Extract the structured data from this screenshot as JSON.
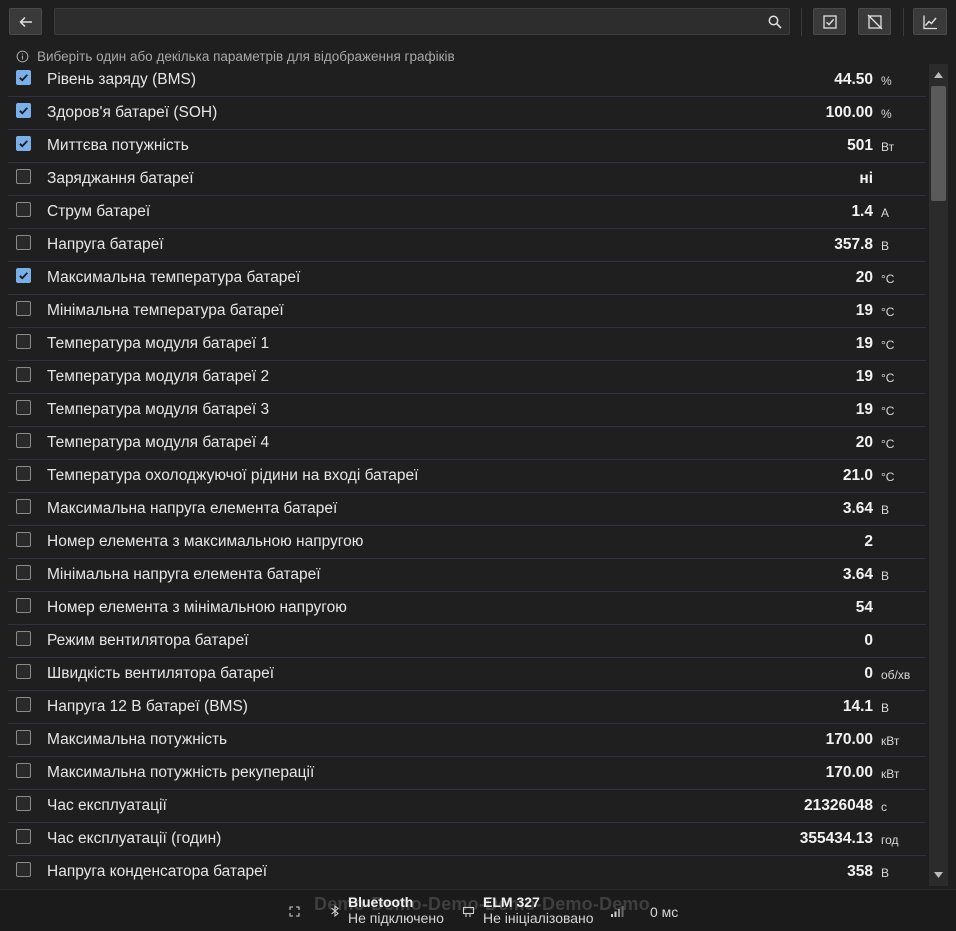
{
  "toolbar": {
    "search": {
      "value": "",
      "placeholder": ""
    },
    "icons": [
      "arrow-left-icon",
      "search-icon",
      "select-all-icon",
      "deselect-all-icon",
      "chart-icon"
    ]
  },
  "info": {
    "text": "Виберіть один або декілька параметрів для відображення графіків"
  },
  "parameters": [
    {
      "label": "Рівень заряду (BMS)",
      "value": "44.50",
      "unit": "%",
      "checked": true
    },
    {
      "label": "Здоров'я батареї (SOH)",
      "value": "100.00",
      "unit": "%",
      "checked": true
    },
    {
      "label": "Миттєва потужність",
      "value": "501",
      "unit": "Вт",
      "checked": true
    },
    {
      "label": "Заряджання батареї",
      "value": "ні",
      "unit": "",
      "checked": false
    },
    {
      "label": "Струм батареї",
      "value": "1.4",
      "unit": "А",
      "checked": false
    },
    {
      "label": "Напруга батареї",
      "value": "357.8",
      "unit": "В",
      "checked": false
    },
    {
      "label": "Максимальна температура батареї",
      "value": "20",
      "unit": "°C",
      "checked": true
    },
    {
      "label": "Мінімальна температура батареї",
      "value": "19",
      "unit": "°C",
      "checked": false
    },
    {
      "label": "Температура модуля батареї 1",
      "value": "19",
      "unit": "°C",
      "checked": false
    },
    {
      "label": "Температура модуля батареї 2",
      "value": "19",
      "unit": "°C",
      "checked": false
    },
    {
      "label": "Температура модуля батареї 3",
      "value": "19",
      "unit": "°C",
      "checked": false
    },
    {
      "label": "Температура модуля батареї 4",
      "value": "20",
      "unit": "°C",
      "checked": false
    },
    {
      "label": "Температура охолоджуючої рідини на вході батареї",
      "value": "21.0",
      "unit": "°C",
      "checked": false
    },
    {
      "label": "Максимальна напруга елемента батареї",
      "value": "3.64",
      "unit": "В",
      "checked": false
    },
    {
      "label": "Номер елемента з максимальною напругою",
      "value": "2",
      "unit": "",
      "checked": false
    },
    {
      "label": "Мінімальна напруга елемента батареї",
      "value": "3.64",
      "unit": "В",
      "checked": false
    },
    {
      "label": "Номер елемента з мінімальною напругою",
      "value": "54",
      "unit": "",
      "checked": false
    },
    {
      "label": "Режим вентилятора батареї",
      "value": "0",
      "unit": "",
      "checked": false
    },
    {
      "label": "Швидкість вентилятора батареї",
      "value": "0",
      "unit": "об/хв",
      "checked": false
    },
    {
      "label": "Напруга 12 В батареї (BMS)",
      "value": "14.1",
      "unit": "В",
      "checked": false
    },
    {
      "label": "Максимальна потужність",
      "value": "170.00",
      "unit": "кВт",
      "checked": false
    },
    {
      "label": "Максимальна потужність рекуперації",
      "value": "170.00",
      "unit": "кВт",
      "checked": false
    },
    {
      "label": "Час експлуатації",
      "value": "21326048",
      "unit": "с",
      "checked": false
    },
    {
      "label": "Час експлуатації (годин)",
      "value": "355434.13",
      "unit": "год",
      "checked": false
    },
    {
      "label": "Напруга конденсатора батареї",
      "value": "358",
      "unit": "В",
      "checked": false
    }
  ],
  "statusbar": {
    "watermark": "Demo-Demo-Demo-Demo-Demo-Demo",
    "connection": {
      "title": "Bluetooth",
      "status": "Не підключено"
    },
    "adapter": {
      "title": "ELM 327",
      "status": "Не ініціалізовано"
    },
    "latency": "0 мс"
  },
  "colors": {
    "background": "#1f1f1f",
    "checkbox_checked": "#7ab0ea",
    "row_separator": "#2e3140"
  }
}
